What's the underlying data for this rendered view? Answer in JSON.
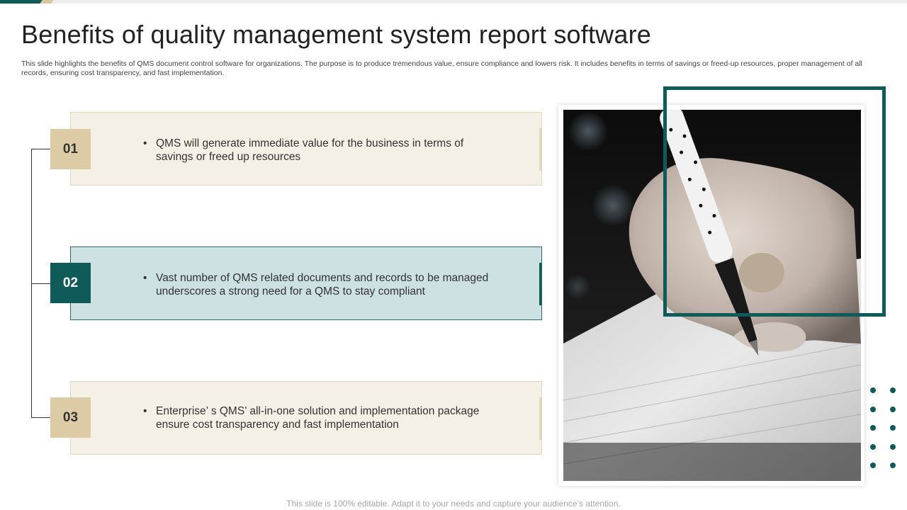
{
  "slide": {
    "title": "Benefits of quality management system report software",
    "subtitle": "This slide highlights the benefits of QMS document control software for organizations. The purpose is to produce tremendous value, ensure compliance and lowers risk. It includes benefits in terms of savings or freed-up resources, proper management of all records, ensuring cost transparency, and fast implementation.",
    "footer": "This slide is 100% editable. Adapt it to your needs and capture your audience’s attention."
  },
  "benefits": [
    {
      "number": "01",
      "text": "QMS will generate immediate value for the business in terms of savings or freed up resources"
    },
    {
      "number": "02",
      "text": "Vast number of QMS related documents and records to be managed underscores a strong need for a QMS to stay compliant"
    },
    {
      "number": "03",
      "text": "Enterprise’ s QMS’ all-in-one solution and implementation package ensure cost transparency and fast implementation"
    }
  ],
  "bullet_char": "•",
  "colors": {
    "accent_teal": "#0f5b5a",
    "accent_beige": "#dccba5",
    "card_beige": "#f5f0e5",
    "card_teal": "#cde0e2"
  },
  "image": {
    "subject": "hand-writing-with-pen-photo"
  }
}
